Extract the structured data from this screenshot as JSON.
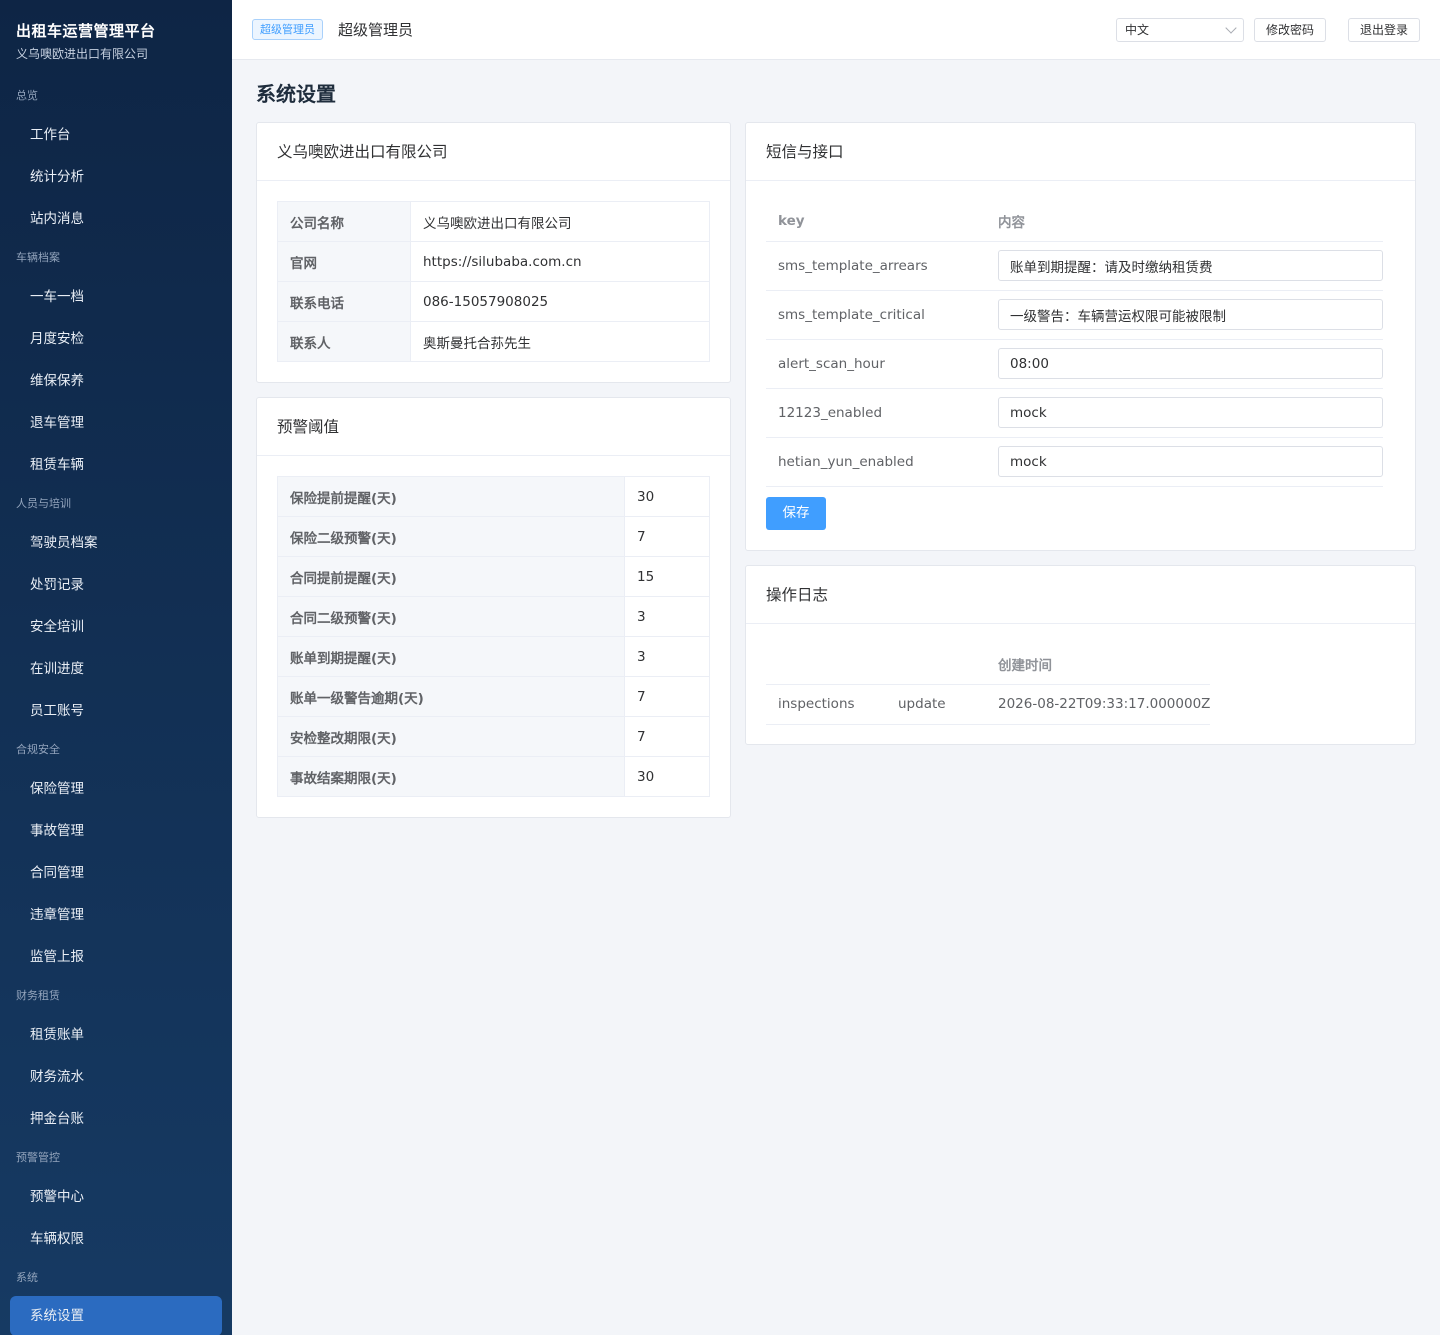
{
  "sidebar": {
    "brand_title": "出租车运营管理平台",
    "brand_sub": "义乌噢欧进出口有限公司",
    "groups": [
      {
        "title": "总览",
        "items": [
          "工作台",
          "统计分析",
          "站内消息"
        ]
      },
      {
        "title": "车辆档案",
        "items": [
          "一车一档",
          "月度安检",
          "维保保养",
          "退车管理",
          "租赁车辆"
        ]
      },
      {
        "title": "人员与培训",
        "items": [
          "驾驶员档案",
          "处罚记录",
          "安全培训",
          "在训进度",
          "员工账号"
        ]
      },
      {
        "title": "合规安全",
        "items": [
          "保险管理",
          "事故管理",
          "合同管理",
          "违章管理",
          "监管上报"
        ]
      },
      {
        "title": "财务租赁",
        "items": [
          "租赁账单",
          "财务流水",
          "押金台账"
        ]
      },
      {
        "title": "预警管控",
        "items": [
          "预警中心",
          "车辆权限"
        ]
      },
      {
        "title": "系统",
        "items": [
          "系统设置"
        ]
      }
    ],
    "active": "系统设置"
  },
  "header": {
    "role_tag": "超级管理员",
    "user_name": "超级管理员",
    "language": "中文",
    "change_password": "修改密码",
    "logout": "退出登录"
  },
  "page_title": "系统设置",
  "company": {
    "title": "义乌噢欧进出口有限公司",
    "rows": [
      {
        "k": "公司名称",
        "v": "义乌噢欧进出口有限公司"
      },
      {
        "k": "官网",
        "v": "https://silubaba.com.cn"
      },
      {
        "k": "联系电话",
        "v": "086-15057908025"
      },
      {
        "k": "联系人",
        "v": "奥斯曼托合荪先生"
      }
    ]
  },
  "thresholds": {
    "title": "预警阈值",
    "rows": [
      {
        "k": "保险提前提醒(天)",
        "v": "30"
      },
      {
        "k": "保险二级预警(天)",
        "v": "7"
      },
      {
        "k": "合同提前提醒(天)",
        "v": "15"
      },
      {
        "k": "合同二级预警(天)",
        "v": "3"
      },
      {
        "k": "账单到期提醒(天)",
        "v": "3"
      },
      {
        "k": "账单一级警告逾期(天)",
        "v": "7"
      },
      {
        "k": "安检整改期限(天)",
        "v": "7"
      },
      {
        "k": "事故结案期限(天)",
        "v": "30"
      }
    ]
  },
  "sms": {
    "title": "短信与接口",
    "col_key": "key",
    "col_content": "内容",
    "rows": [
      {
        "key": "sms_template_arrears",
        "value": "账单到期提醒：请及时缴纳租赁费"
      },
      {
        "key": "sms_template_critical",
        "value": "一级警告：车辆营运权限可能被限制"
      },
      {
        "key": "alert_scan_hour",
        "value": "08:00"
      },
      {
        "key": "12123_enabled",
        "value": "mock"
      },
      {
        "key": "hetian_yun_enabled",
        "value": "mock"
      }
    ],
    "save_label": "保存"
  },
  "oplog": {
    "title": "操作日志",
    "col_time": "创建时间",
    "rows": [
      {
        "module": "inspections",
        "action": "update",
        "time": "2026-08-22T09:33:17.000000Z"
      }
    ]
  }
}
